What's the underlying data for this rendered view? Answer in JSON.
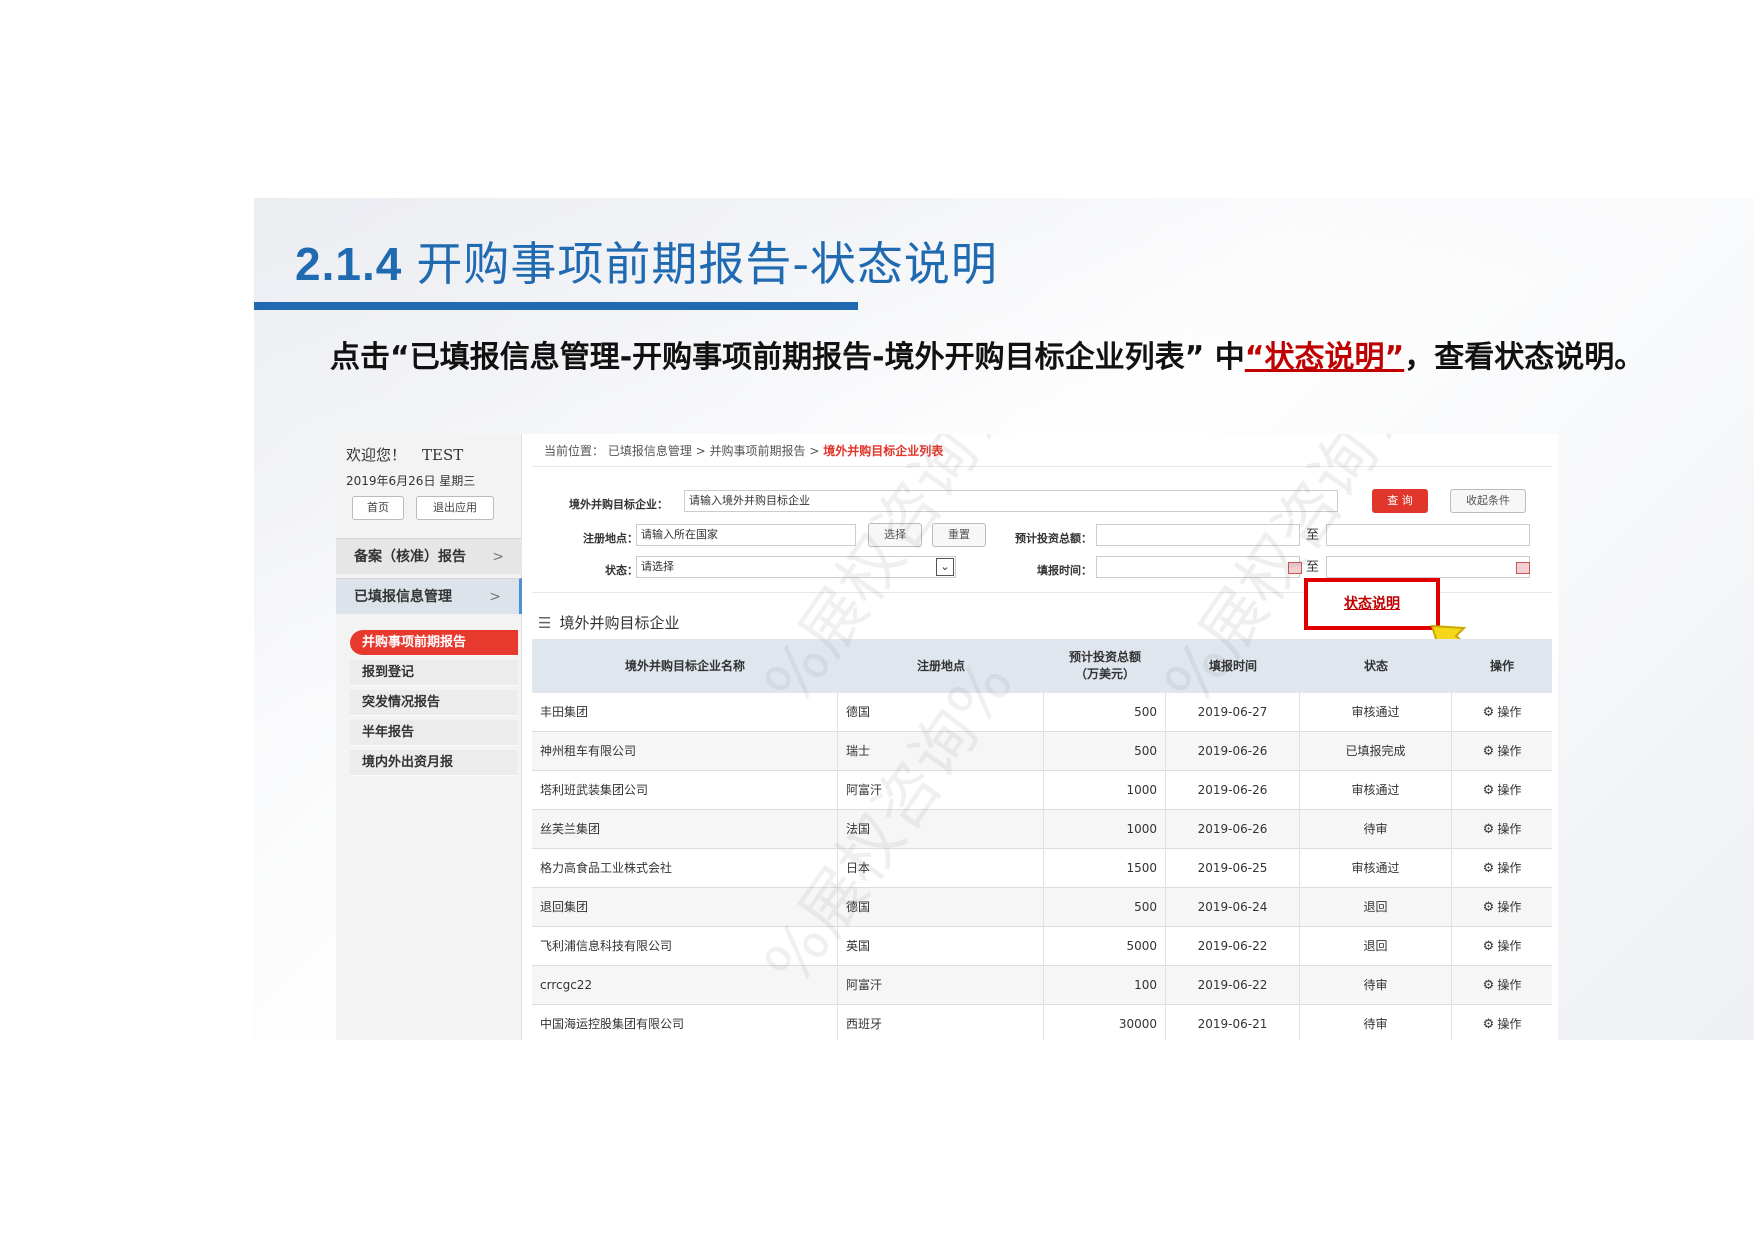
{
  "slide": {
    "section_number": "2.1.4",
    "title": "开购事项前期报告-状态说明",
    "instruction_prefix": "点击“已填报信息管理-开购事项前期报告-境外开购目标企业列表” 中",
    "instruction_link": "“状态说明”",
    "instruction_suffix": "，查看状态说明。",
    "watermark": "%展权咨询%",
    "accent_color": "#1f6ab1"
  },
  "sidebar": {
    "welcome": "欢迎您！",
    "user": "TEST",
    "date": "2019年6月26日 星期三",
    "home_button": "首页",
    "exit_button": "退出应用",
    "menus": [
      {
        "label": "备案（核准）报告",
        "arrow": ">"
      },
      {
        "label": "已填报信息管理",
        "arrow": ">"
      }
    ],
    "sub_items": [
      {
        "label": "并购事项前期报告"
      },
      {
        "label": "报到登记"
      },
      {
        "label": "突发情况报告"
      },
      {
        "label": "半年报告"
      },
      {
        "label": "境内外出资月报"
      }
    ]
  },
  "breadcrumb": {
    "prefix": "当前位置：",
    "items": "已填报信息管理 > 并购事项前期报告 >",
    "current": "境外并购目标企业列表"
  },
  "filters": {
    "company_label": "境外并购目标企业：",
    "company_placeholder": "请输入境外并购目标企业",
    "query_button": "查 询",
    "collapse_button": "收起条件",
    "location_label": "注册地点：",
    "location_placeholder": "请输入所在国家",
    "select_button": "选择",
    "reset_button": "重置",
    "investment_label": "预计投资总额：",
    "to1": "至",
    "status_label": "状态：",
    "status_value": "请选择",
    "fill_time_label": "填报时间：",
    "to2": "至"
  },
  "status_button": "状态说明",
  "list": {
    "title": "境外并购目标企业",
    "headers": [
      "境外并购目标企业名称",
      "注册地点",
      "预计投资总额\n（万美元）",
      "填报时间",
      "状态",
      "操作"
    ],
    "rows": [
      {
        "name": "丰田集团",
        "loc": "德国",
        "amt": "500",
        "date": "2019-06-27",
        "status": "审核通过",
        "op": "操作"
      },
      {
        "name": "神州租车有限公司",
        "loc": "瑞士",
        "amt": "500",
        "date": "2019-06-26",
        "status": "已填报完成",
        "op": "操作"
      },
      {
        "name": "塔利班武装集团公司",
        "loc": "阿富汗",
        "amt": "1000",
        "date": "2019-06-26",
        "status": "审核通过",
        "op": "操作"
      },
      {
        "name": "丝芙兰集团",
        "loc": "法国",
        "amt": "1000",
        "date": "2019-06-26",
        "status": "待审",
        "op": "操作"
      },
      {
        "name": "格力高食品工业株式会社",
        "loc": "日本",
        "amt": "1500",
        "date": "2019-06-25",
        "status": "审核通过",
        "op": "操作"
      },
      {
        "name": "退回集团",
        "loc": "德国",
        "amt": "500",
        "date": "2019-06-24",
        "status": "退回",
        "op": "操作"
      },
      {
        "name": "飞利浦信息科技有限公司",
        "loc": "英国",
        "amt": "5000",
        "date": "2019-06-22",
        "status": "退回",
        "op": "操作"
      },
      {
        "name": "crrcgc22",
        "loc": "阿富汗",
        "amt": "100",
        "date": "2019-06-22",
        "status": "待审",
        "op": "操作"
      },
      {
        "name": "中国海运控股集团有限公司",
        "loc": "西班牙",
        "amt": "30000",
        "date": "2019-06-21",
        "status": "待审",
        "op": "操作"
      }
    ]
  }
}
